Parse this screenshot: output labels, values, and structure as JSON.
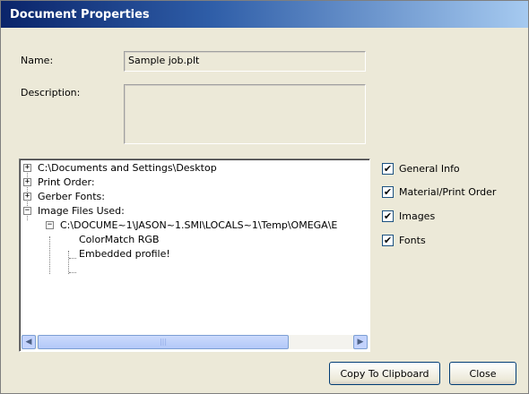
{
  "window": {
    "title": "Document Properties"
  },
  "fields": {
    "name_label": "Name:",
    "name_value": "Sample job.plt",
    "description_label": "Description:",
    "description_value": ""
  },
  "tree": {
    "nodes": [
      {
        "label": "C:\\Documents and Settings\\Desktop",
        "expander": "+"
      },
      {
        "label": "Print Order:",
        "expander": "+"
      },
      {
        "label": "Gerber Fonts:",
        "expander": "+"
      },
      {
        "label": "Image Files Used:",
        "expander": "−"
      },
      {
        "label": "C:\\DOCUME~1\\JASON~1.SMI\\LOCALS~1\\Temp\\OMEGA\\E",
        "expander": "−"
      },
      {
        "label": "ColorMatch RGB"
      },
      {
        "label": "Embedded profile!"
      }
    ],
    "scroll_thumb_grip": "|||"
  },
  "checkboxes": [
    {
      "label": "General Info",
      "checked": true
    },
    {
      "label": "Material/Print Order",
      "checked": true
    },
    {
      "label": "Images",
      "checked": true
    },
    {
      "label": "Fonts",
      "checked": true
    }
  ],
  "buttons": {
    "copy": "Copy To Clipboard",
    "close": "Close"
  },
  "icons": {
    "checkmark": "✔",
    "scroll_left": "◀",
    "scroll_right": "▶"
  }
}
